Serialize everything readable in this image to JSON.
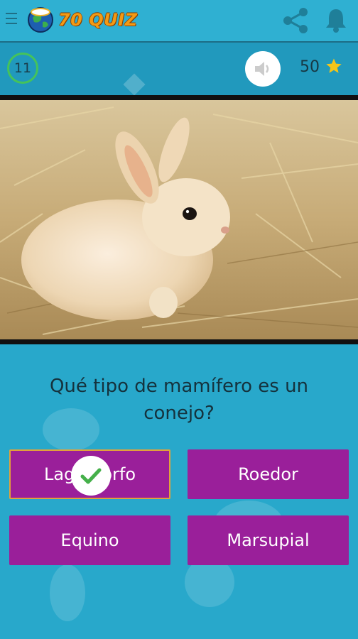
{
  "header": {
    "app_name": "70 QUIZ",
    "icons": [
      "menu-icon",
      "globe-logo-icon",
      "share-icon",
      "bell-icon"
    ]
  },
  "status": {
    "timer": "11",
    "score": "50",
    "icons": [
      "speaker-icon",
      "star-icon"
    ],
    "timer_color": "#45c35a"
  },
  "question": {
    "image": "rabbit-photo",
    "text": "Qué tipo de mamífero es un conejo?"
  },
  "answers": [
    {
      "label": "Lagomorfo",
      "selected": true
    },
    {
      "label": "Roedor",
      "selected": false
    },
    {
      "label": "Equino",
      "selected": false
    },
    {
      "label": "Marsupial",
      "selected": false
    }
  ],
  "colors": {
    "header": "#2fb0d2",
    "status_bar": "#2199bd",
    "answer_button": "#9a1f9a",
    "check": "#45b04a"
  }
}
